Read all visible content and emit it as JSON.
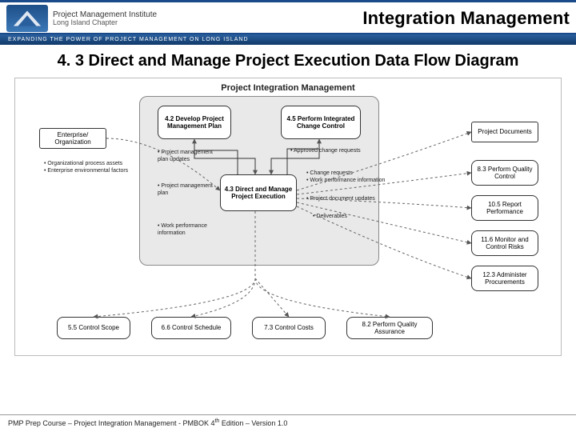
{
  "header": {
    "logo_line1": "Project Management Institute",
    "logo_line2": "Long Island Chapter",
    "title": "Integration Management",
    "tagline": "EXPANDING THE POWER OF PROJECT MANAGEMENT ON LONG ISLAND"
  },
  "slide": {
    "title": "4. 3 Direct and Manage Project Execution Data Flow Diagram"
  },
  "diagram": {
    "pim_title": "Project Integration Management",
    "boxes": {
      "b42": "4.2\nDevelop Project\nManagement\nPlan",
      "b45": "4.5\nPerform\nIntegrated Change\nControl",
      "b43": "4.3\nDirect and\nManage Project\nExecution",
      "ent": "Enterprise/\nOrganization",
      "pdocs": "Project\nDocuments",
      "b83": "8.3\nPerform\nQuality Control",
      "b105": "10.5\nReport\nPerformance",
      "b116": "11.6\nMonitor and\nControl Risks",
      "b123": "12.3\nAdminister\nProcurements",
      "b55": "5.5\nControl Scope",
      "b66": "6.6\nControl Schedule",
      "b73": "7.3\nControl Costs",
      "b82": "8.2\nPerform Quality\nAssurance"
    },
    "bullets": {
      "ent": [
        "Organizational process assets",
        "Enterprise environmental factors"
      ],
      "mid_left": [
        "Project management plan updates"
      ],
      "mid_left2": [
        "Project management plan"
      ],
      "mid_right_top": [
        "Approved change requests"
      ],
      "mid_right": [
        "Change requests",
        "Work performance information"
      ],
      "mid_right2": [
        "Project document updates"
      ],
      "deliv": [
        "Deliverables"
      ],
      "wpi": [
        "Work performance information"
      ]
    }
  },
  "footer": {
    "text_pre": "PMP Prep Course – Project Integration Management - PMBOK 4",
    "text_sup": "th",
    "text_post": " Edition – Version 1.0"
  }
}
